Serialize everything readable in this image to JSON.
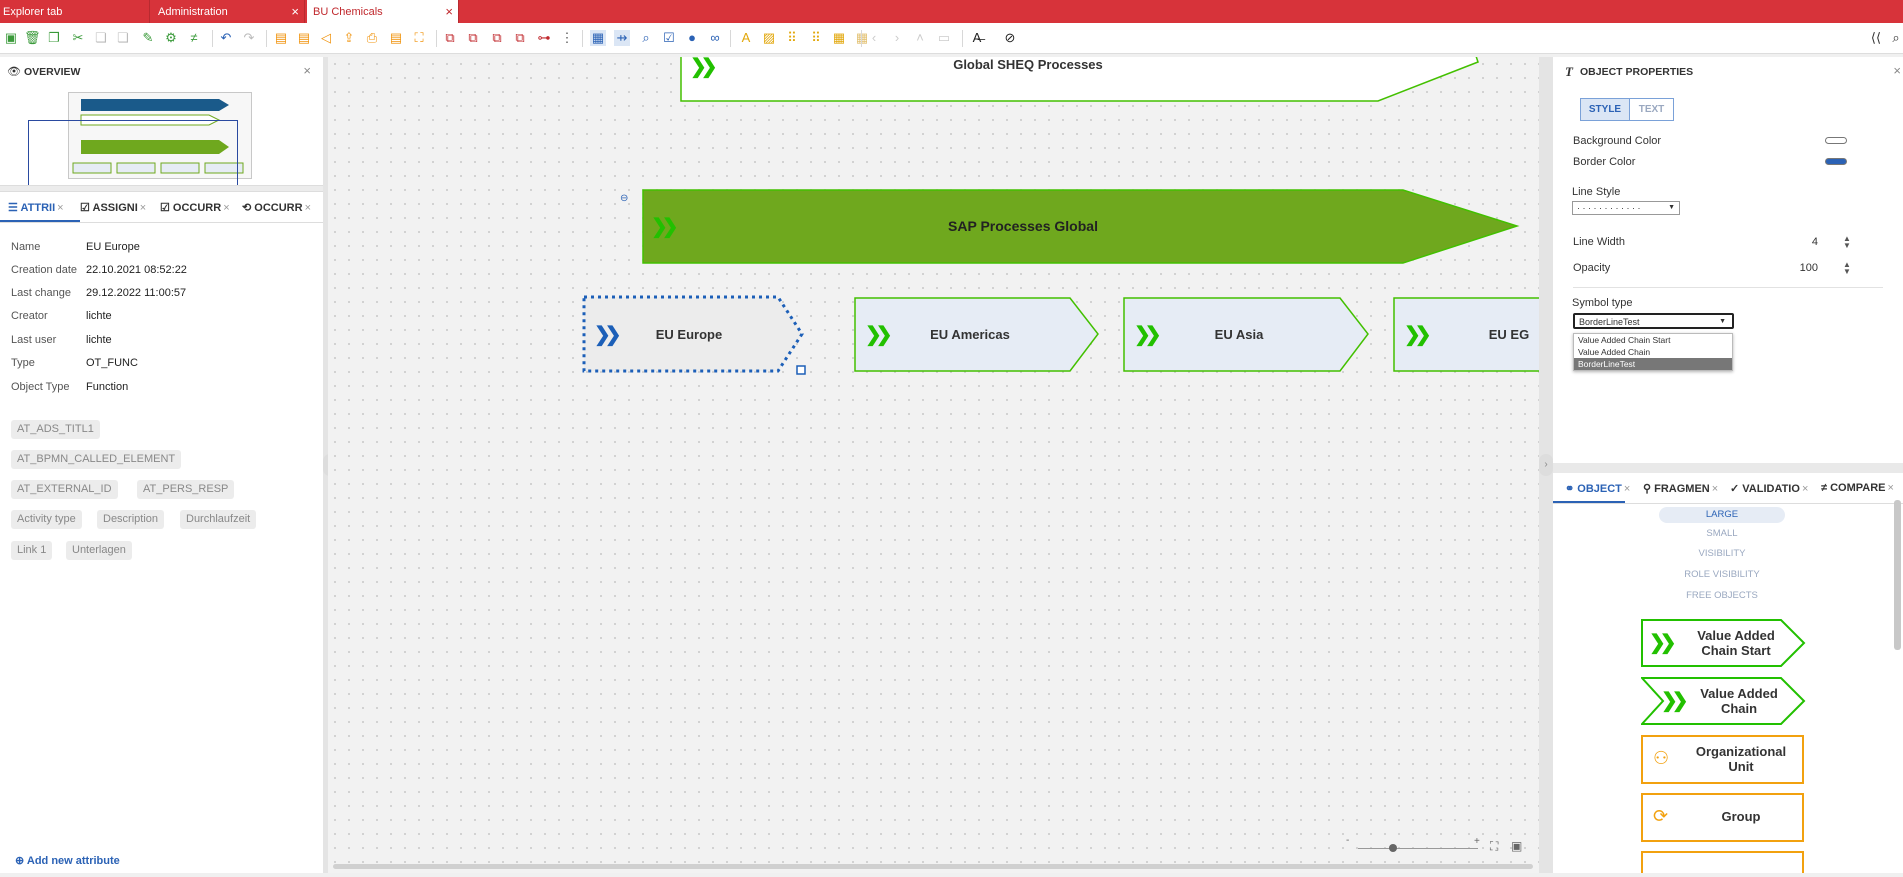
{
  "tabs": [
    {
      "label": "Explorer tab"
    },
    {
      "label": "Administration"
    },
    {
      "label": "BU Chemicals"
    }
  ],
  "overview": {
    "title": "OVERVIEW"
  },
  "left_tabs": [
    {
      "label": "ATTRII"
    },
    {
      "label": "ASSIGNI"
    },
    {
      "label": "OCCURR"
    },
    {
      "label": "OCCURR"
    }
  ],
  "attributes": [
    {
      "name": "Name",
      "value": "EU Europe"
    },
    {
      "name": "Creation date",
      "value": "22.10.2021 08:52:22"
    },
    {
      "name": "Last change",
      "value": "29.12.2022 11:00:57"
    },
    {
      "name": "Creator",
      "value": "lichte"
    },
    {
      "name": "Last user",
      "value": "lichte"
    },
    {
      "name": "Type",
      "value": "OT_FUNC"
    },
    {
      "name": "Object Type",
      "value": "Function"
    }
  ],
  "attribute_chips": [
    "AT_ADS_TITL1",
    "AT_BPMN_CALLED_ELEMENT",
    "AT_EXTERNAL_ID",
    "AT_PERS_RESP",
    "Activity type",
    "Description",
    "Durchlaufzeit",
    "Link 1",
    "Unterlagen"
  ],
  "add_attribute": "Add new attribute",
  "canvas": {
    "shapes": [
      {
        "label": "Global SHEQ Processes"
      },
      {
        "label": "SAP Processes Global"
      },
      {
        "label": "EU Europe"
      },
      {
        "label": "EU Americas"
      },
      {
        "label": "EU Asia"
      },
      {
        "label": "EU EG"
      }
    ],
    "zoom_minus": "-",
    "zoom_plus": "+"
  },
  "object_properties": {
    "title": "OBJECT PROPERTIES",
    "style_tab": "STYLE",
    "text_tab": "TEXT",
    "background_color_label": "Background Color",
    "border_color_label": "Border Color",
    "background_color": "#ffffff",
    "border_color": "#2b62b5",
    "line_style_label": "Line Style",
    "line_style_value": "· · · · · · · · · · · ·",
    "line_width_label": "Line Width",
    "line_width": "4",
    "opacity_label": "Opacity",
    "opacity": "100",
    "symbol_type_label": "Symbol type",
    "symbol_type_value": "BorderLineTest",
    "symbol_type_options": [
      "Value Added Chain Start",
      "Value Added Chain",
      "BorderLineTest"
    ]
  },
  "right_tabs": [
    {
      "label": "OBJECT"
    },
    {
      "label": "FRAGMEN"
    },
    {
      "label": "VALIDATIO"
    },
    {
      "label": "COMPARE"
    }
  ],
  "filters": [
    "LARGE",
    "SMALL",
    "VISIBILITY",
    "ROLE VISIBILITY",
    "FREE OBJECTS"
  ],
  "symbols": [
    {
      "label": "Value Added Chain Start"
    },
    {
      "label": "Value Added Chain"
    },
    {
      "label": "Organizational Unit"
    },
    {
      "label": "Group"
    }
  ],
  "colors": {
    "accent_red": "#d7333a",
    "brand_blue": "#2b62b5",
    "vac_green": "#6fa81e",
    "chain_green": "#22c000",
    "org_orange": "#f2a10f"
  }
}
